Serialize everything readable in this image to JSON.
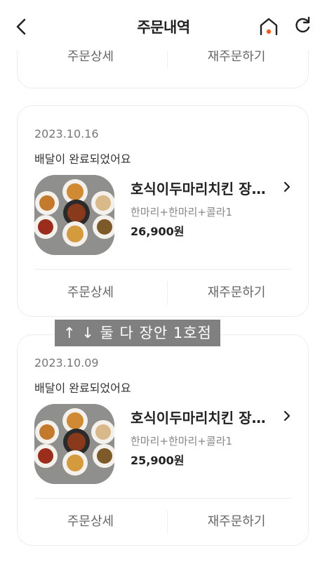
{
  "header": {
    "title": "주문내역",
    "back_icon": "chevron-left-icon",
    "home_icon": "home-icon",
    "refresh_icon": "refresh-icon",
    "accent": "#ff5a1f"
  },
  "top_card": {
    "detail_label": "주문상세",
    "reorder_label": "재주문하기"
  },
  "orders": [
    {
      "date": "2023.10.16",
      "status": "배달이 완료되었어요",
      "store": "호식이두마리치킨 장…",
      "menu": "한마리+한마리+콜라1",
      "price": "26,900원",
      "detail_label": "주문상세",
      "reorder_label": "재주문하기"
    },
    {
      "date": "2023.10.09",
      "status": "배달이 완료되었어요",
      "store": "호식이두마리치킨 장…",
      "menu": "한마리+한마리+콜라1",
      "price": "25,900원",
      "detail_label": "주문상세",
      "reorder_label": "재주문하기"
    }
  ],
  "overlay": {
    "text": "↑ ↓ 둘 다 장안 1호점"
  }
}
